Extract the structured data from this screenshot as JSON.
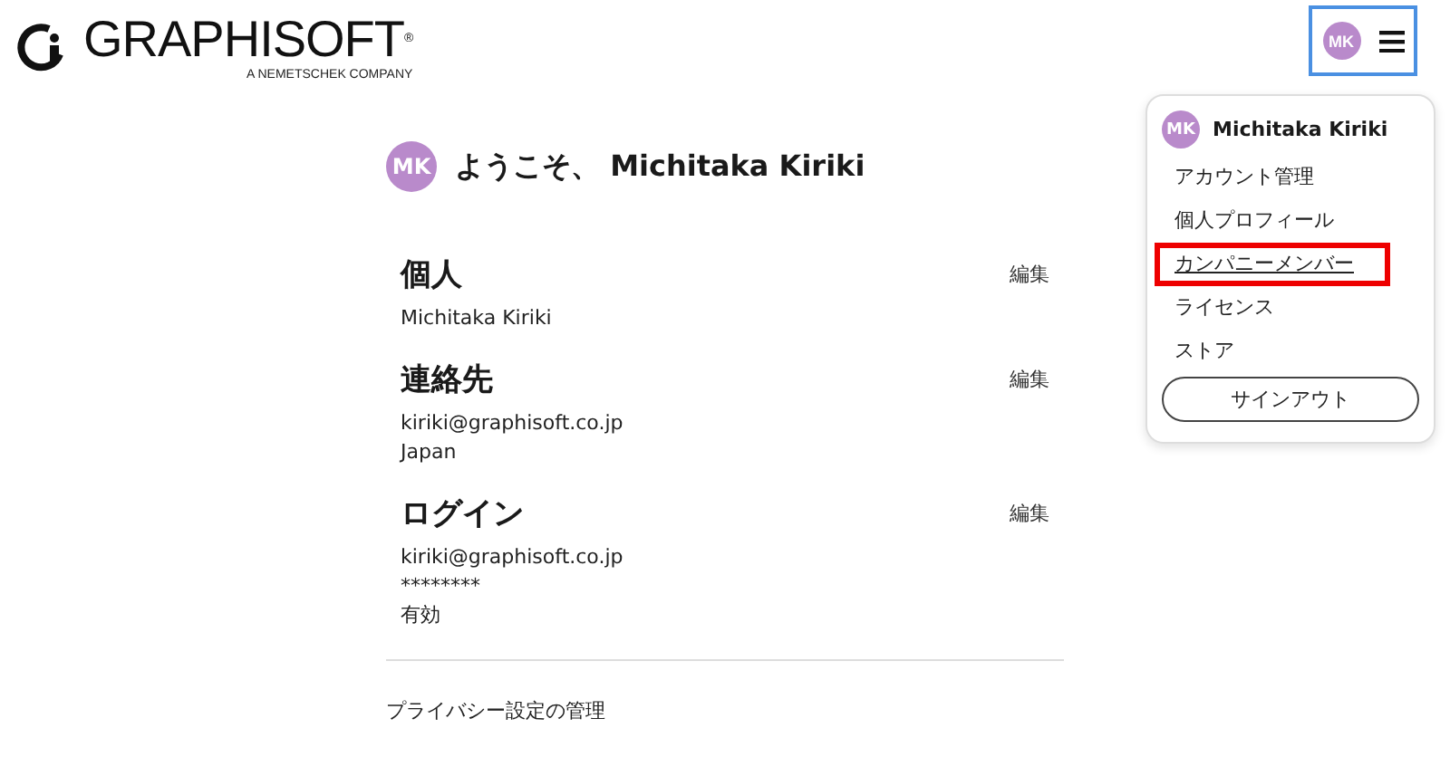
{
  "header": {
    "logo": {
      "name": "GRAPHISOFT",
      "registered": "®",
      "tagline": "A NEMETSCHEK COMPANY"
    },
    "user_button": {
      "initials": "MK"
    }
  },
  "user_menu": {
    "initials": "MK",
    "name": "Michitaka Kiriki",
    "items": [
      {
        "label": "アカウント管理",
        "highlighted": false
      },
      {
        "label": "個人プロフィール",
        "highlighted": false
      },
      {
        "label": "カンパニーメンバー",
        "highlighted": true
      },
      {
        "label": "ライセンス",
        "highlighted": false
      },
      {
        "label": "ストア",
        "highlighted": false
      }
    ],
    "sign_out": "サインアウト"
  },
  "welcome": {
    "initials": "MK",
    "text": "ようこそ、 Michitaka Kiriki"
  },
  "sections": [
    {
      "title": "個人",
      "edit": "編集",
      "lines": [
        "Michitaka Kiriki"
      ]
    },
    {
      "title": "連絡先",
      "edit": "編集",
      "lines": [
        "kiriki@graphisoft.co.jp",
        "Japan"
      ]
    },
    {
      "title": "ログイン",
      "edit": "編集",
      "lines": [
        "kiriki@graphisoft.co.jp",
        "********",
        "有効"
      ]
    }
  ],
  "privacy_link": "プライバシー設定の管理"
}
